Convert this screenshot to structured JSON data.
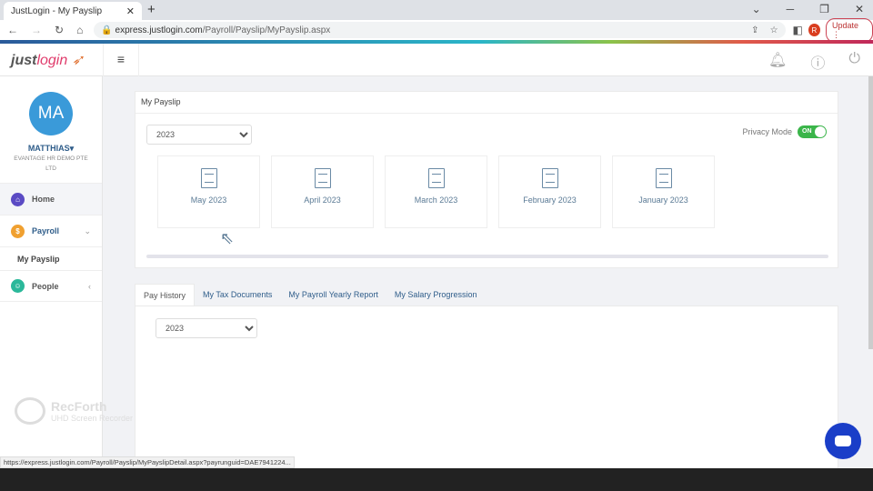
{
  "browser": {
    "tab_title": "JustLogin - My Payslip",
    "url_host": "express.justlogin.com",
    "url_path": "/Payroll/Payslip/MyPayslip.aspx",
    "profile_initial": "R",
    "update_label": "Update",
    "status_url": "https://express.justlogin.com/Payroll/Payslip/MyPayslipDetail.aspx?payrunguid=DAE7941224..."
  },
  "logo": {
    "just": "just",
    "login": "login"
  },
  "user": {
    "initials": "MA",
    "name": "MATTHIAS",
    "org": "EVANTAGE HR DEMO PTE LTD"
  },
  "sidebar": {
    "items": [
      {
        "label": "Home"
      },
      {
        "label": "Payroll"
      },
      {
        "label": "My Payslip"
      },
      {
        "label": "People"
      }
    ]
  },
  "payslip": {
    "title": "My Payslip",
    "year": "2023",
    "privacy_label": "Privacy Mode",
    "privacy_state": "ON",
    "months": [
      "May 2023",
      "April 2023",
      "March 2023",
      "February 2023",
      "January 2023"
    ]
  },
  "tabs": [
    "Pay History",
    "My Tax Documents",
    "My Payroll Yearly Report",
    "My Salary Progression"
  ],
  "history": {
    "year": "2023"
  },
  "watermark": {
    "title": "RecForth",
    "subtitle": "UHD Screen Recorder"
  }
}
